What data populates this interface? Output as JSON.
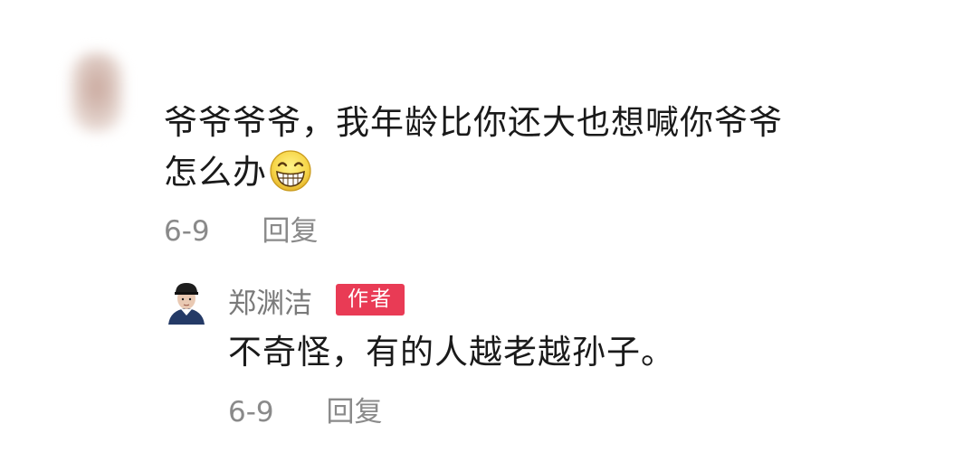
{
  "comment": {
    "text_line1": "爷爷爷爷，我年龄比你还大也想喊你爷爷",
    "text_line2": "怎么办",
    "emoji": "grinning-face-emoji",
    "date": "6-9",
    "reply_label": "回复"
  },
  "reply": {
    "author_name": "郑渊洁",
    "author_badge": "作者",
    "text": "不奇怪，有的人越老越孙子。",
    "date": "6-9",
    "reply_label": "回复"
  },
  "colors": {
    "badge_bg": "#e93b55",
    "meta_text": "#8a8a8a",
    "author_name": "#7a7a7a",
    "body_text": "#1a1a1a"
  }
}
